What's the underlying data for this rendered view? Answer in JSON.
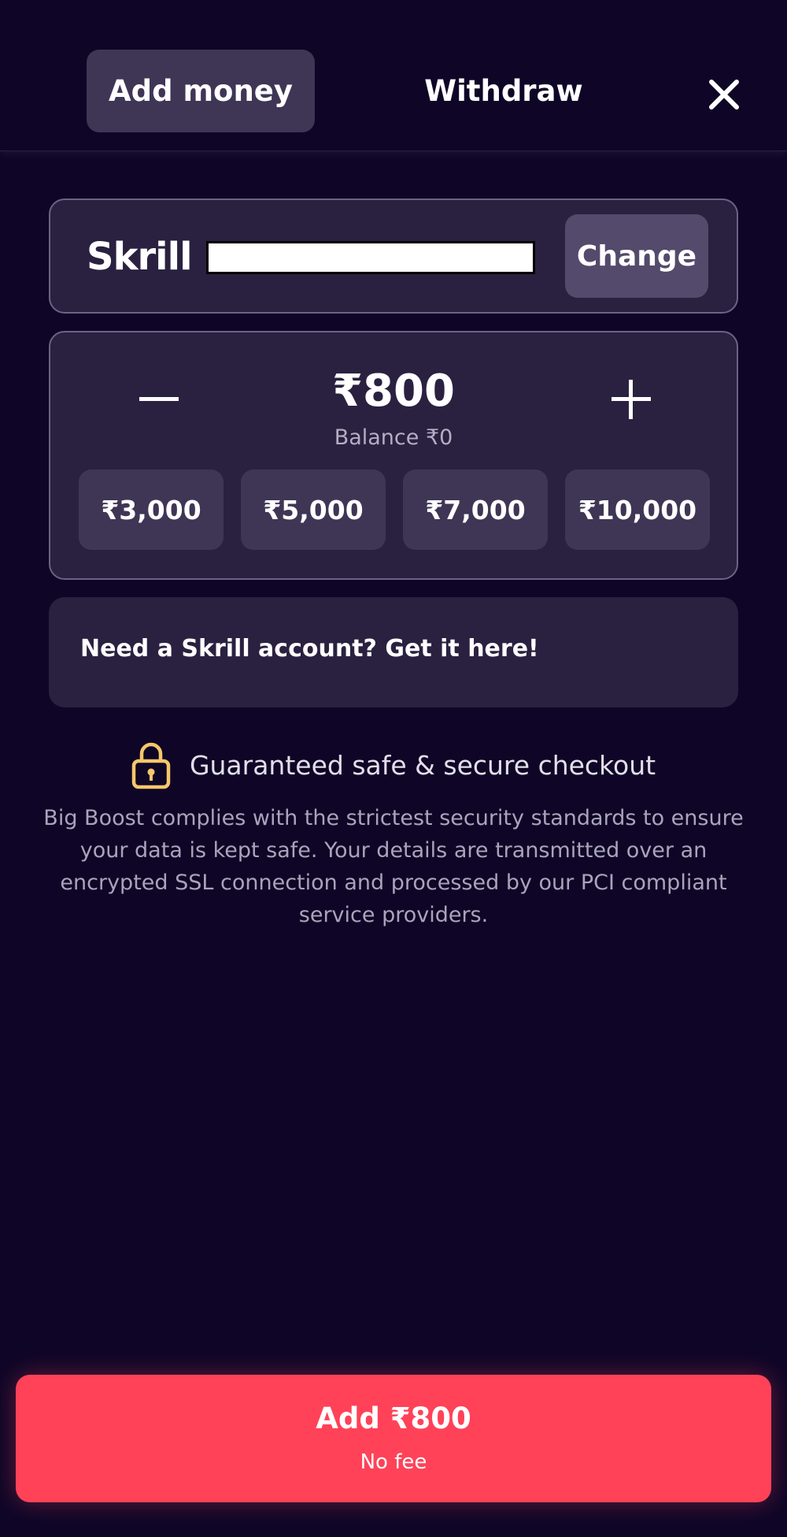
{
  "tabs": {
    "add_money": "Add money",
    "withdraw": "Withdraw",
    "active": "add_money"
  },
  "close": {
    "icon": "close-icon"
  },
  "method": {
    "brand": "Skrill",
    "account_value": "",
    "change_label": "Change"
  },
  "amount": {
    "value": "₹800",
    "balance": "Balance ₹0",
    "minus_icon": "minus-icon",
    "plus_icon": "plus-icon",
    "presets": [
      "₹3,000",
      "₹5,000",
      "₹7,000",
      "₹10,000"
    ]
  },
  "signup": {
    "text": "Need a Skrill account? Get it here!"
  },
  "security": {
    "icon": "lock-icon",
    "title": "Guaranteed safe & secure checkout",
    "description": "Big Boost complies with the strictest security standards to ensure your data is kept safe. Your details are transmitted over an encrypted SSL connection and processed by our PCI compliant service providers."
  },
  "cta": {
    "label": "Add ₹800",
    "sublabel": "No fee"
  },
  "colors": {
    "background": "#0f0627",
    "card": "#2a2140",
    "tab_active": "#3f3656",
    "accent": "#ff4258",
    "lock": "#f5c76a"
  }
}
